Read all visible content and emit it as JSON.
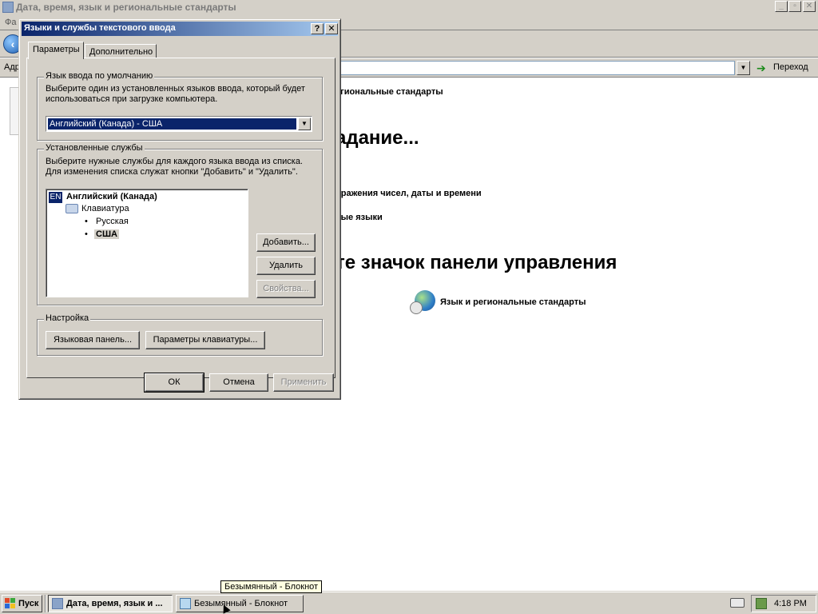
{
  "background_window": {
    "title": "Дата, время, язык и региональные стандарты",
    "menu_partial": "Фа",
    "address_label": "Адр",
    "go_label": "Переход",
    "breadcrumb_partial": "егиональные стандарты",
    "task_heading_partial": "адание...",
    "task_link1_partial": "бражения чисел, даты и времени",
    "task_link2_partial": "ные языки",
    "icon_heading_partial": "те значок панели управления",
    "cp_icon_label": "Язык и региональные стандарты"
  },
  "dialog": {
    "title": "Языки и службы текстового ввода",
    "help_button": "?",
    "close_button": "✕",
    "tabs": [
      {
        "label": "Параметры",
        "active": true
      },
      {
        "label": "Дополнительно",
        "active": false
      }
    ],
    "default_input": {
      "group_label": "Язык ввода по умолчанию",
      "description": "Выберите один из установленных языков ввода, который будет использоваться при загрузке компьютера.",
      "selected": "Английский (Канада) - США"
    },
    "installed_services": {
      "group_label": "Установленные службы",
      "description": "Выберите нужные службы для каждого языка ввода из списка. Для изменения списка служат кнопки \"Добавить\" и \"Удалить\".",
      "language_badge": "EN",
      "language_name": "Английский (Канада)",
      "keyboard_label": "Клавиатура",
      "layouts": [
        "Русская",
        "США"
      ],
      "add_button": "Добавить...",
      "remove_button": "Удалить",
      "properties_button": "Свойства..."
    },
    "settings": {
      "group_label": "Настройка",
      "language_bar_button": "Языковая панель...",
      "key_settings_button": "Параметры клавиатуры..."
    },
    "ok_button": "ОК",
    "cancel_button": "Отмена",
    "apply_button": "Применить"
  },
  "tooltip": "Безымянный - Блокнот",
  "taskbar": {
    "start_label": "Пуск",
    "tasks": [
      {
        "label": "Дата, время, язык и ...",
        "active": true
      },
      {
        "label": "Безымянный - Блокнот",
        "active": false
      }
    ],
    "clock": "4:18 PM"
  }
}
